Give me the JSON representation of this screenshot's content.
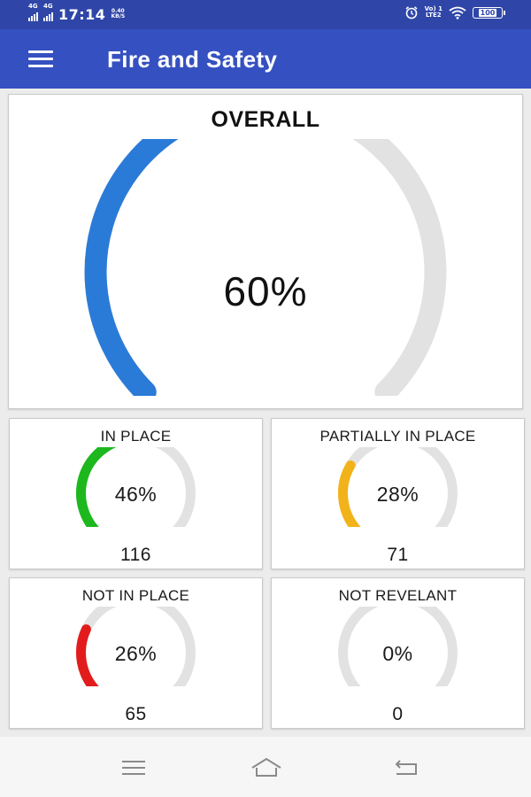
{
  "status_bar": {
    "sim1_type": "4G",
    "sim2_type": "4G",
    "time": "17:14",
    "net_speed_value": "0.40",
    "net_speed_unit": "KB/S",
    "volte_top": "Vo) 1",
    "volte_bottom": "LTE2",
    "battery": "100"
  },
  "app_bar": {
    "title": "Fire and Safety"
  },
  "overall": {
    "title": "OVERALL",
    "value_label": "60%",
    "value": 60,
    "color": "#2a7bd8"
  },
  "cards": [
    {
      "label": "IN PLACE",
      "percent_label": "46%",
      "percent": 46,
      "count": "116",
      "color": "#1db81d"
    },
    {
      "label": "PARTIALLY IN PLACE",
      "percent_label": "28%",
      "percent": 28,
      "count": "71",
      "color": "#f2b31a"
    },
    {
      "label": "NOT IN PLACE",
      "percent_label": "26%",
      "percent": 26,
      "count": "65",
      "color": "#e21c1c"
    },
    {
      "label": "NOT REVELANT",
      "percent_label": "0%",
      "percent": 0,
      "count": "0",
      "color": "#9e9e9e"
    }
  ],
  "gauge_track_color": "#e2e2e2",
  "nav_bar": {
    "icons": [
      "recent-apps-icon",
      "home-icon",
      "back-icon"
    ]
  }
}
